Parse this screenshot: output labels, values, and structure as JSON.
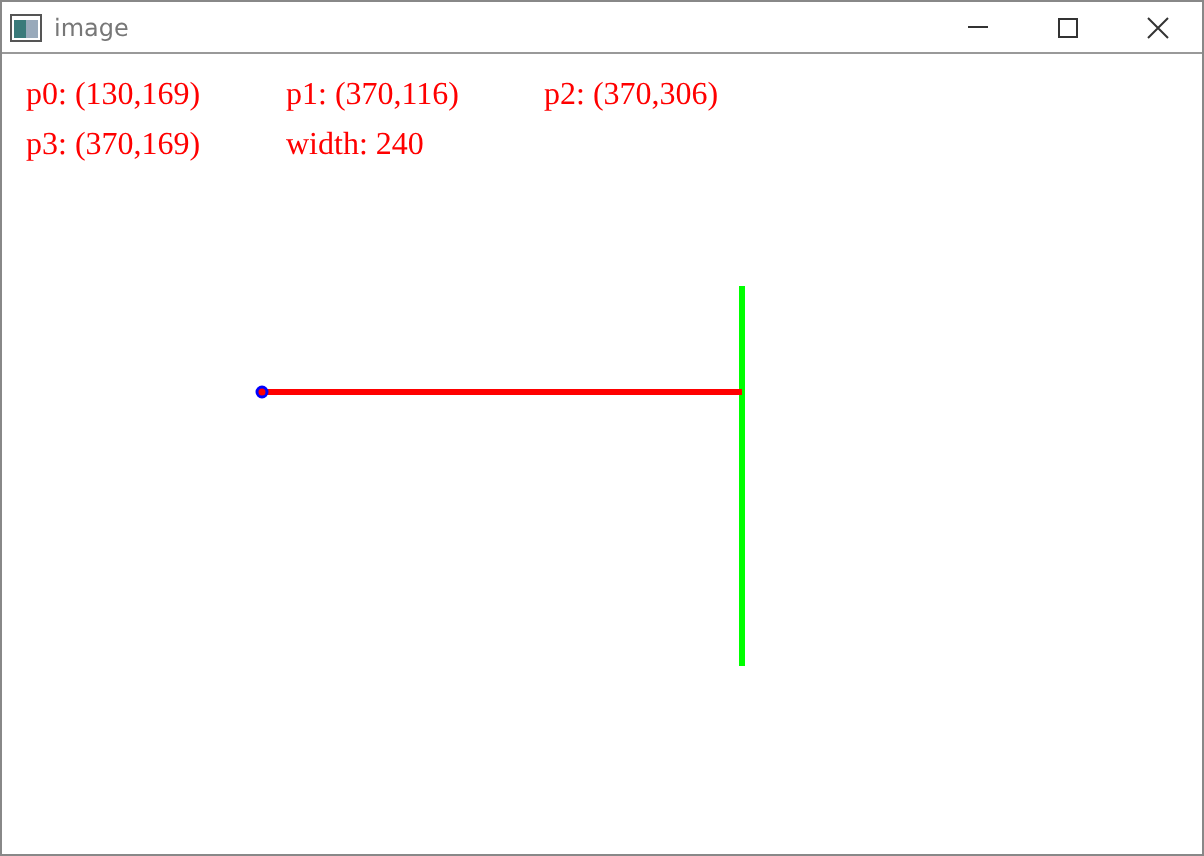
{
  "window": {
    "title": "image"
  },
  "canvas": {
    "labels": [
      [
        "p0: (130,169)",
        "p1: (370,116)",
        "p2: (370,306)"
      ],
      [
        "p3: (370,169)",
        "width: 240"
      ]
    ]
  }
}
